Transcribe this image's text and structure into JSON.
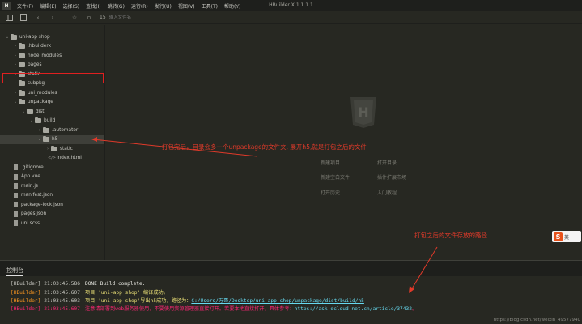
{
  "app": {
    "logo_text": "H",
    "window_title": "HBuilder X 1.1.1.1",
    "menu": [
      "文件(F)",
      "编辑(E)",
      "选择(S)",
      "查找(I)",
      "跳转(G)",
      "运行(R)",
      "发行(U)",
      "视图(V)",
      "工具(T)",
      "帮助(Y)"
    ]
  },
  "toolbar": {
    "address_label": "15",
    "address_placeholder": "输入文件名"
  },
  "sidebar": {
    "items": [
      {
        "label": "uni-app shop",
        "depth": 0,
        "type": "folder",
        "expanded": true
      },
      {
        "label": ".hbuilderx",
        "depth": 1,
        "type": "folder",
        "expanded": false
      },
      {
        "label": "node_modules",
        "depth": 1,
        "type": "folder",
        "expanded": false
      },
      {
        "label": "pages",
        "depth": 1,
        "type": "folder",
        "expanded": false
      },
      {
        "label": "static",
        "depth": 1,
        "type": "folder",
        "expanded": false
      },
      {
        "label": "subpkg",
        "depth": 1,
        "type": "folder",
        "expanded": false
      },
      {
        "label": "uni_modules",
        "depth": 1,
        "type": "folder",
        "expanded": false
      },
      {
        "label": "unpackage",
        "depth": 1,
        "type": "folder",
        "expanded": true
      },
      {
        "label": "dist",
        "depth": 2,
        "type": "folder",
        "expanded": true
      },
      {
        "label": "build",
        "depth": 3,
        "type": "folder",
        "expanded": true
      },
      {
        "label": ".automator",
        "depth": 4,
        "type": "folder",
        "expanded": false
      },
      {
        "label": "h5",
        "depth": 4,
        "type": "folder",
        "expanded": true,
        "selected": true
      },
      {
        "label": "static",
        "depth": 5,
        "type": "folder",
        "expanded": false
      },
      {
        "label": "index.html",
        "depth": 5,
        "type": "code"
      },
      {
        "label": ".gitignore",
        "depth": 1,
        "type": "file"
      },
      {
        "label": "App.vue",
        "depth": 1,
        "type": "file"
      },
      {
        "label": "main.js",
        "depth": 1,
        "type": "file"
      },
      {
        "label": "manifest.json",
        "depth": 1,
        "type": "file"
      },
      {
        "label": "package-lock.json",
        "depth": 1,
        "type": "file"
      },
      {
        "label": "pages.json",
        "depth": 1,
        "type": "file"
      },
      {
        "label": "uni.scss",
        "depth": 1,
        "type": "file"
      }
    ]
  },
  "editor": {
    "logo_text": "H",
    "welcome": {
      "new_project": "新建项目",
      "open_dir": "打开目录",
      "new_blank_file": "新建空白文件",
      "plugin_market": "插件扩展市场",
      "open_recent": "打开历史",
      "getting_started": "入门教程"
    }
  },
  "annotations": {
    "note1": "打包完后，目录会多一个unpackage的文件夹, 展开h5,就是打包之后的文件",
    "note2": "打包之后的文件存放的路径",
    "color": "#e03a2a"
  },
  "ime": {
    "logo": "S",
    "label": "英"
  },
  "console": {
    "tab_label": "控制台",
    "lines": [
      {
        "tag": "[HBuilder]",
        "time": "21:03:45.586",
        "parts": [
          {
            "t": "DONE  Build complete.",
            "c": "white"
          }
        ],
        "tag_color": "default"
      },
      {
        "tag": "[HBuilder]",
        "time": "21:03:45.607",
        "parts": [
          {
            "t": "项目 'uni-app shop' 编译成功。",
            "c": "yellow"
          }
        ],
        "tag_color": "orange"
      },
      {
        "tag": "[HBuilder]",
        "time": "21:03:45.603",
        "parts": [
          {
            "t": "项目 'uni-app shop'导出h5成功，路径为：",
            "c": "yellow"
          },
          {
            "t": "C:/Users/万哥/Desktop/uni-app shop/unpackage/dist/build/h5",
            "c": "link"
          }
        ],
        "tag_color": "orange"
      },
      {
        "tag": "[HBuilder]",
        "time": "21:03:45.607",
        "parts": [
          {
            "t": "注意请部署到web服务器使用，不要使用资源管理器直接打开。若要本地直接打开，具体参考：",
            "c": "red"
          },
          {
            "t": "https://ask.dcloud.net.cn/article/37432",
            "c": "blue"
          },
          {
            "t": "。",
            "c": "red"
          }
        ],
        "tag_color": "red"
      }
    ],
    "watermark": "https://blog.csdn.net/weixin_49577940"
  },
  "colors": {
    "background": "#272822",
    "menubar": "#1e1f1c",
    "highlight_border": "#e02020"
  }
}
